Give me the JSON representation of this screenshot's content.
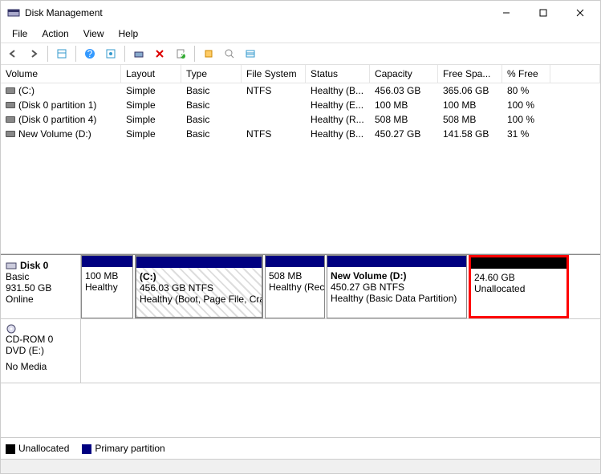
{
  "window": {
    "title": "Disk Management"
  },
  "menu": {
    "file": "File",
    "action": "Action",
    "view": "View",
    "help": "Help"
  },
  "columns": {
    "volume": "Volume",
    "layout": "Layout",
    "type": "Type",
    "fs": "File System",
    "status": "Status",
    "capacity": "Capacity",
    "free": "Free Spa...",
    "pct": "% Free"
  },
  "volumes": [
    {
      "name": "(C:)",
      "layout": "Simple",
      "type": "Basic",
      "fs": "NTFS",
      "status": "Healthy (B...",
      "capacity": "456.03 GB",
      "free": "365.06 GB",
      "pct": "80 %"
    },
    {
      "name": "(Disk 0 partition 1)",
      "layout": "Simple",
      "type": "Basic",
      "fs": "",
      "status": "Healthy (E...",
      "capacity": "100 MB",
      "free": "100 MB",
      "pct": "100 %"
    },
    {
      "name": "(Disk 0 partition 4)",
      "layout": "Simple",
      "type": "Basic",
      "fs": "",
      "status": "Healthy (R...",
      "capacity": "508 MB",
      "free": "508 MB",
      "pct": "100 %"
    },
    {
      "name": "New Volume (D:)",
      "layout": "Simple",
      "type": "Basic",
      "fs": "NTFS",
      "status": "Healthy (B...",
      "capacity": "450.27 GB",
      "free": "141.58 GB",
      "pct": "31 %"
    }
  ],
  "disk0": {
    "name": "Disk 0",
    "type": "Basic",
    "size": "931.50 GB",
    "state": "Online",
    "parts": [
      {
        "line1": "",
        "line2": "100 MB",
        "line3": "Healthy"
      },
      {
        "line1": "(C:)",
        "line2": "456.03 GB NTFS",
        "line3": "Healthy (Boot, Page File, Crash"
      },
      {
        "line1": "",
        "line2": "508 MB",
        "line3": "Healthy (Rec"
      },
      {
        "line1": "New Volume  (D:)",
        "line2": "450.27 GB NTFS",
        "line3": "Healthy (Basic Data Partition)"
      },
      {
        "line1": "",
        "line2": "24.60 GB",
        "line3": "Unallocated"
      }
    ]
  },
  "cdrom": {
    "name": "CD-ROM 0",
    "type": "DVD (E:)",
    "state": "No Media"
  },
  "legend": {
    "unalloc": "Unallocated",
    "primary": "Primary partition"
  }
}
